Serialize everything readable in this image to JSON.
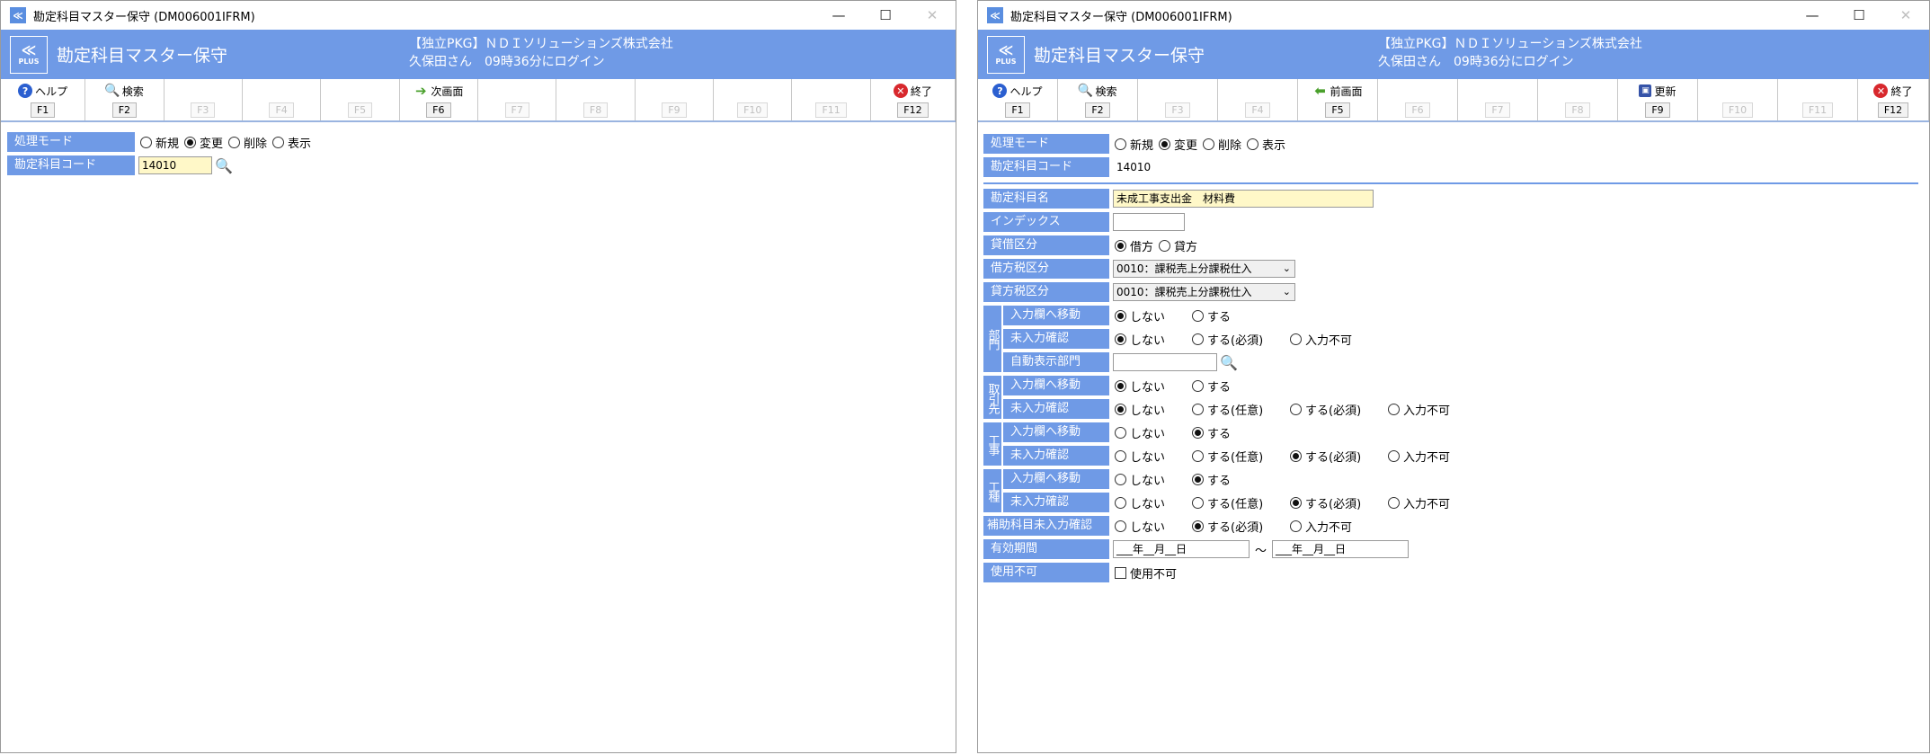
{
  "window": {
    "title": "勘定科目マスター保守 (DM006001IFRM)",
    "app_title": "勘定科目マスター保守",
    "company": "【独立PKG】ＮＤＩソリューションズ株式会社",
    "login": "久保田さん　09時36分にログイン",
    "logo_text": "PLUS"
  },
  "fkeys_left": [
    {
      "label": "ヘルプ",
      "num": "F1",
      "icon": "help-icon"
    },
    {
      "label": "検索",
      "num": "F2",
      "icon": "search-icon"
    },
    {
      "label": "",
      "num": "F3"
    },
    {
      "label": "",
      "num": "F4"
    },
    {
      "label": "",
      "num": "F5"
    },
    {
      "label": "次画面",
      "num": "F6",
      "icon": "arrow-right-icon"
    },
    {
      "label": "",
      "num": "F7"
    },
    {
      "label": "",
      "num": "F8"
    },
    {
      "label": "",
      "num": "F9"
    },
    {
      "label": "",
      "num": "F10"
    },
    {
      "label": "",
      "num": "F11"
    },
    {
      "label": "終了",
      "num": "F12",
      "icon": "close-circle-icon"
    }
  ],
  "fkeys_right": [
    {
      "label": "ヘルプ",
      "num": "F1",
      "icon": "help-icon"
    },
    {
      "label": "検索",
      "num": "F2",
      "icon": "search-icon"
    },
    {
      "label": "",
      "num": "F3"
    },
    {
      "label": "",
      "num": "F4"
    },
    {
      "label": "前画面",
      "num": "F5",
      "icon": "arrow-left-icon"
    },
    {
      "label": "",
      "num": "F6"
    },
    {
      "label": "",
      "num": "F7"
    },
    {
      "label": "",
      "num": "F8"
    },
    {
      "label": "更新",
      "num": "F9",
      "icon": "save-icon"
    },
    {
      "label": "",
      "num": "F10"
    },
    {
      "label": "",
      "num": "F11"
    },
    {
      "label": "終了",
      "num": "F12",
      "icon": "close-circle-icon"
    }
  ],
  "mode": {
    "label": "処理モード",
    "options": [
      "新規",
      "変更",
      "削除",
      "表示"
    ],
    "selected": "変更"
  },
  "code": {
    "label": "勘定科目コード",
    "value": "14010"
  },
  "detail": {
    "name_label": "勘定科目名",
    "name_value": "未成工事支出金　材料費",
    "index_label": "インデックス",
    "index_value": "",
    "taishaku_label": "貸借区分",
    "taishaku_options": [
      "借方",
      "貸方"
    ],
    "taishaku_selected": "借方",
    "karikata_tax_label": "借方税区分",
    "karikata_tax_value": "0010：課税売上分課税仕入",
    "kashikata_tax_label": "貸方税区分",
    "kashikata_tax_value": "0010：課税売上分課税仕入",
    "groups": {
      "bumon": "部門",
      "torihikisaki": "取引先",
      "koji": "工事",
      "koshu": "工種"
    },
    "move_label": "入力欄へ移動",
    "check_label": "未入力確認",
    "auto_bumon_label": "自動表示部門",
    "opt_shinai": "しない",
    "opt_suru": "する",
    "opt_hissu": "する(必須)",
    "opt_nini": "する(任意)",
    "opt_fuka": "入力不可",
    "hojo_label": "補助科目未入力確認",
    "period_label": "有効期間",
    "period_from": "___年__月__日",
    "period_to": "___年__月__日",
    "tilde": "～",
    "disabled_label": "使用不可",
    "disabled_check": "使用不可"
  }
}
